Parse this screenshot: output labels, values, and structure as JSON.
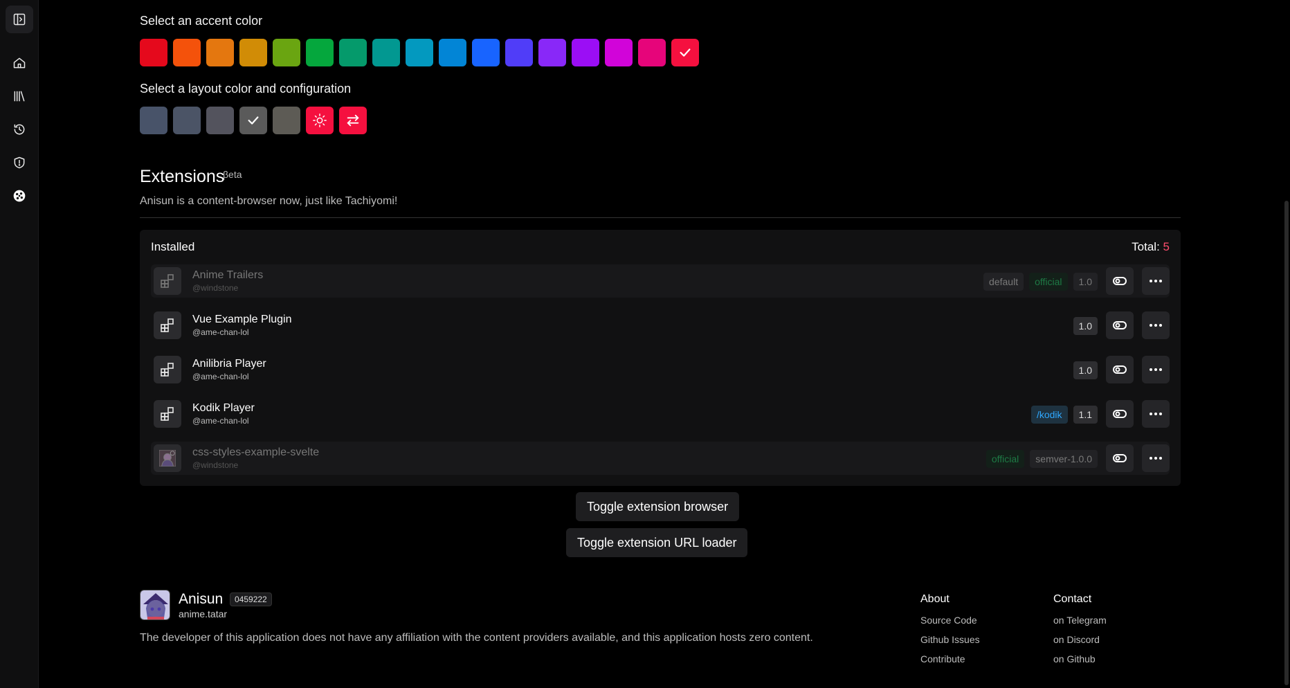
{
  "accent": {
    "label": "Select an accent color",
    "colors": [
      "#e5091c",
      "#f4520b",
      "#e4770f",
      "#d18c06",
      "#6aa511",
      "#05a73d",
      "#059a6b",
      "#029891",
      "#0399bf",
      "#0285d6",
      "#1864ff",
      "#503df8",
      "#8928f8",
      "#9b0ef5",
      "#d104d9",
      "#e6057a",
      "#f5103f"
    ],
    "selected_index": 16
  },
  "layout": {
    "label": "Select a layout color and configuration",
    "colors": [
      "#485369",
      "#4b5466",
      "#53535d",
      "#5a5a5a",
      "#5d5b55"
    ],
    "selected_index": 3,
    "light_mode_icon": "sun-icon",
    "swap_icon": "swap-arrows-icon",
    "action_color": "#f5103f"
  },
  "extensions": {
    "title": "Extensions",
    "beta": "βeta",
    "subtitle": "Anisun is a content-browser now, just like Tachiyomi!",
    "installed_label": "Installed",
    "total_label": "Total:",
    "total_value": "5",
    "items": [
      {
        "name": "Anime Trailers",
        "handle": "@windstone",
        "tags": [
          "default",
          "official",
          "1.0"
        ],
        "disabled": true
      },
      {
        "name": "Vue Example Plugin",
        "handle": "@ame-chan-lol",
        "tags": [
          "1.0"
        ],
        "disabled": false
      },
      {
        "name": "Anilibria Player",
        "handle": "@ame-chan-lol",
        "tags": [
          "1.0"
        ],
        "disabled": false
      },
      {
        "name": "Kodik Player",
        "handle": "@ame-chan-lol",
        "tags": [
          "/kodik",
          "1.1"
        ],
        "disabled": false
      },
      {
        "name": "css-styles-example-svelte",
        "handle": "@windstone",
        "tags": [
          "official",
          "semver-1.0.0"
        ],
        "disabled": true
      }
    ],
    "toggle_browser": "Toggle extension browser",
    "toggle_url_loader": "Toggle extension URL loader"
  },
  "footer": {
    "app_name": "Anisun",
    "version": "0459222",
    "domain": "anime.tatar",
    "disclaimer": "The developer of this application does not have any affiliation with the content providers available, and this application hosts zero content.",
    "about_title": "About",
    "about_links": [
      "Source Code",
      "Github Issues",
      "Contribute"
    ],
    "contact_title": "Contact",
    "contact_links": [
      "on Telegram",
      "on Discord",
      "on Github"
    ]
  },
  "sidebar": {
    "icons": [
      "sidebar-toggle-icon",
      "home-icon",
      "library-icon",
      "history-icon",
      "shield-icon",
      "settings-icon"
    ]
  }
}
